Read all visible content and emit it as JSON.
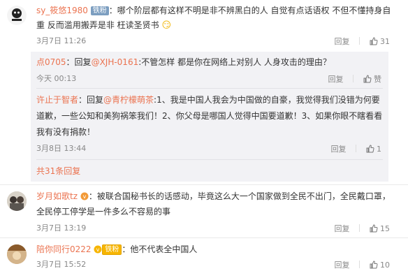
{
  "comments": [
    {
      "username": "sy_筱悠1980",
      "badge": "铁粉",
      "line1": "：哪个阶层都有这样不明是非不辨黑白的人 自觉有点话语权 不但不懂持身自",
      "line2": "重 反而滥用搬弄是非 枉读圣贤书",
      "emoji": "😏",
      "time": "3月7日 11:26",
      "reply_label": "回复",
      "like_count": "31",
      "replies": [
        {
          "username": "点0705",
          "text_prefix": "：回复",
          "mention": "@XJH-0161",
          "text": ":不管怎样 都是你在网络上对别人 人身攻击的理由？",
          "time": "今天 00:13",
          "reply_label": "回复",
          "like_label": "赞"
        },
        {
          "username": "许止于智者",
          "text_prefix": "：回复",
          "mention": "@青柠檬萌茶",
          "line1": ":1、我是中国人我会为中国做的自豪，我觉得我们没错为何要",
          "line2": "道歉，一些公知和美狗祸笨我们！2、你父母是哪国人觉得中国要道歉！3、如果你眼不瞎看看",
          "line3": "我有没有捐款！",
          "time": "3月8日 13:44",
          "reply_label": "回复",
          "like_count": "1"
        }
      ],
      "more_replies": "共31条回复"
    },
    {
      "username": "岁月如歌tz",
      "line1": "：被联合国秘书长的话感动，毕竟这么大一个国家做到全民不出门，全民戴口罩，",
      "line2": "全民停工停学是一件多么不容易的事",
      "time": "3月7日 13:19",
      "reply_label": "回复",
      "like_count": "15"
    },
    {
      "username": "陪你同行0222",
      "badge": "铁粉",
      "line1": "：他不代表全中国人",
      "time": "3月7日 15:52",
      "reply_label": "回复",
      "like_count": "10"
    }
  ]
}
